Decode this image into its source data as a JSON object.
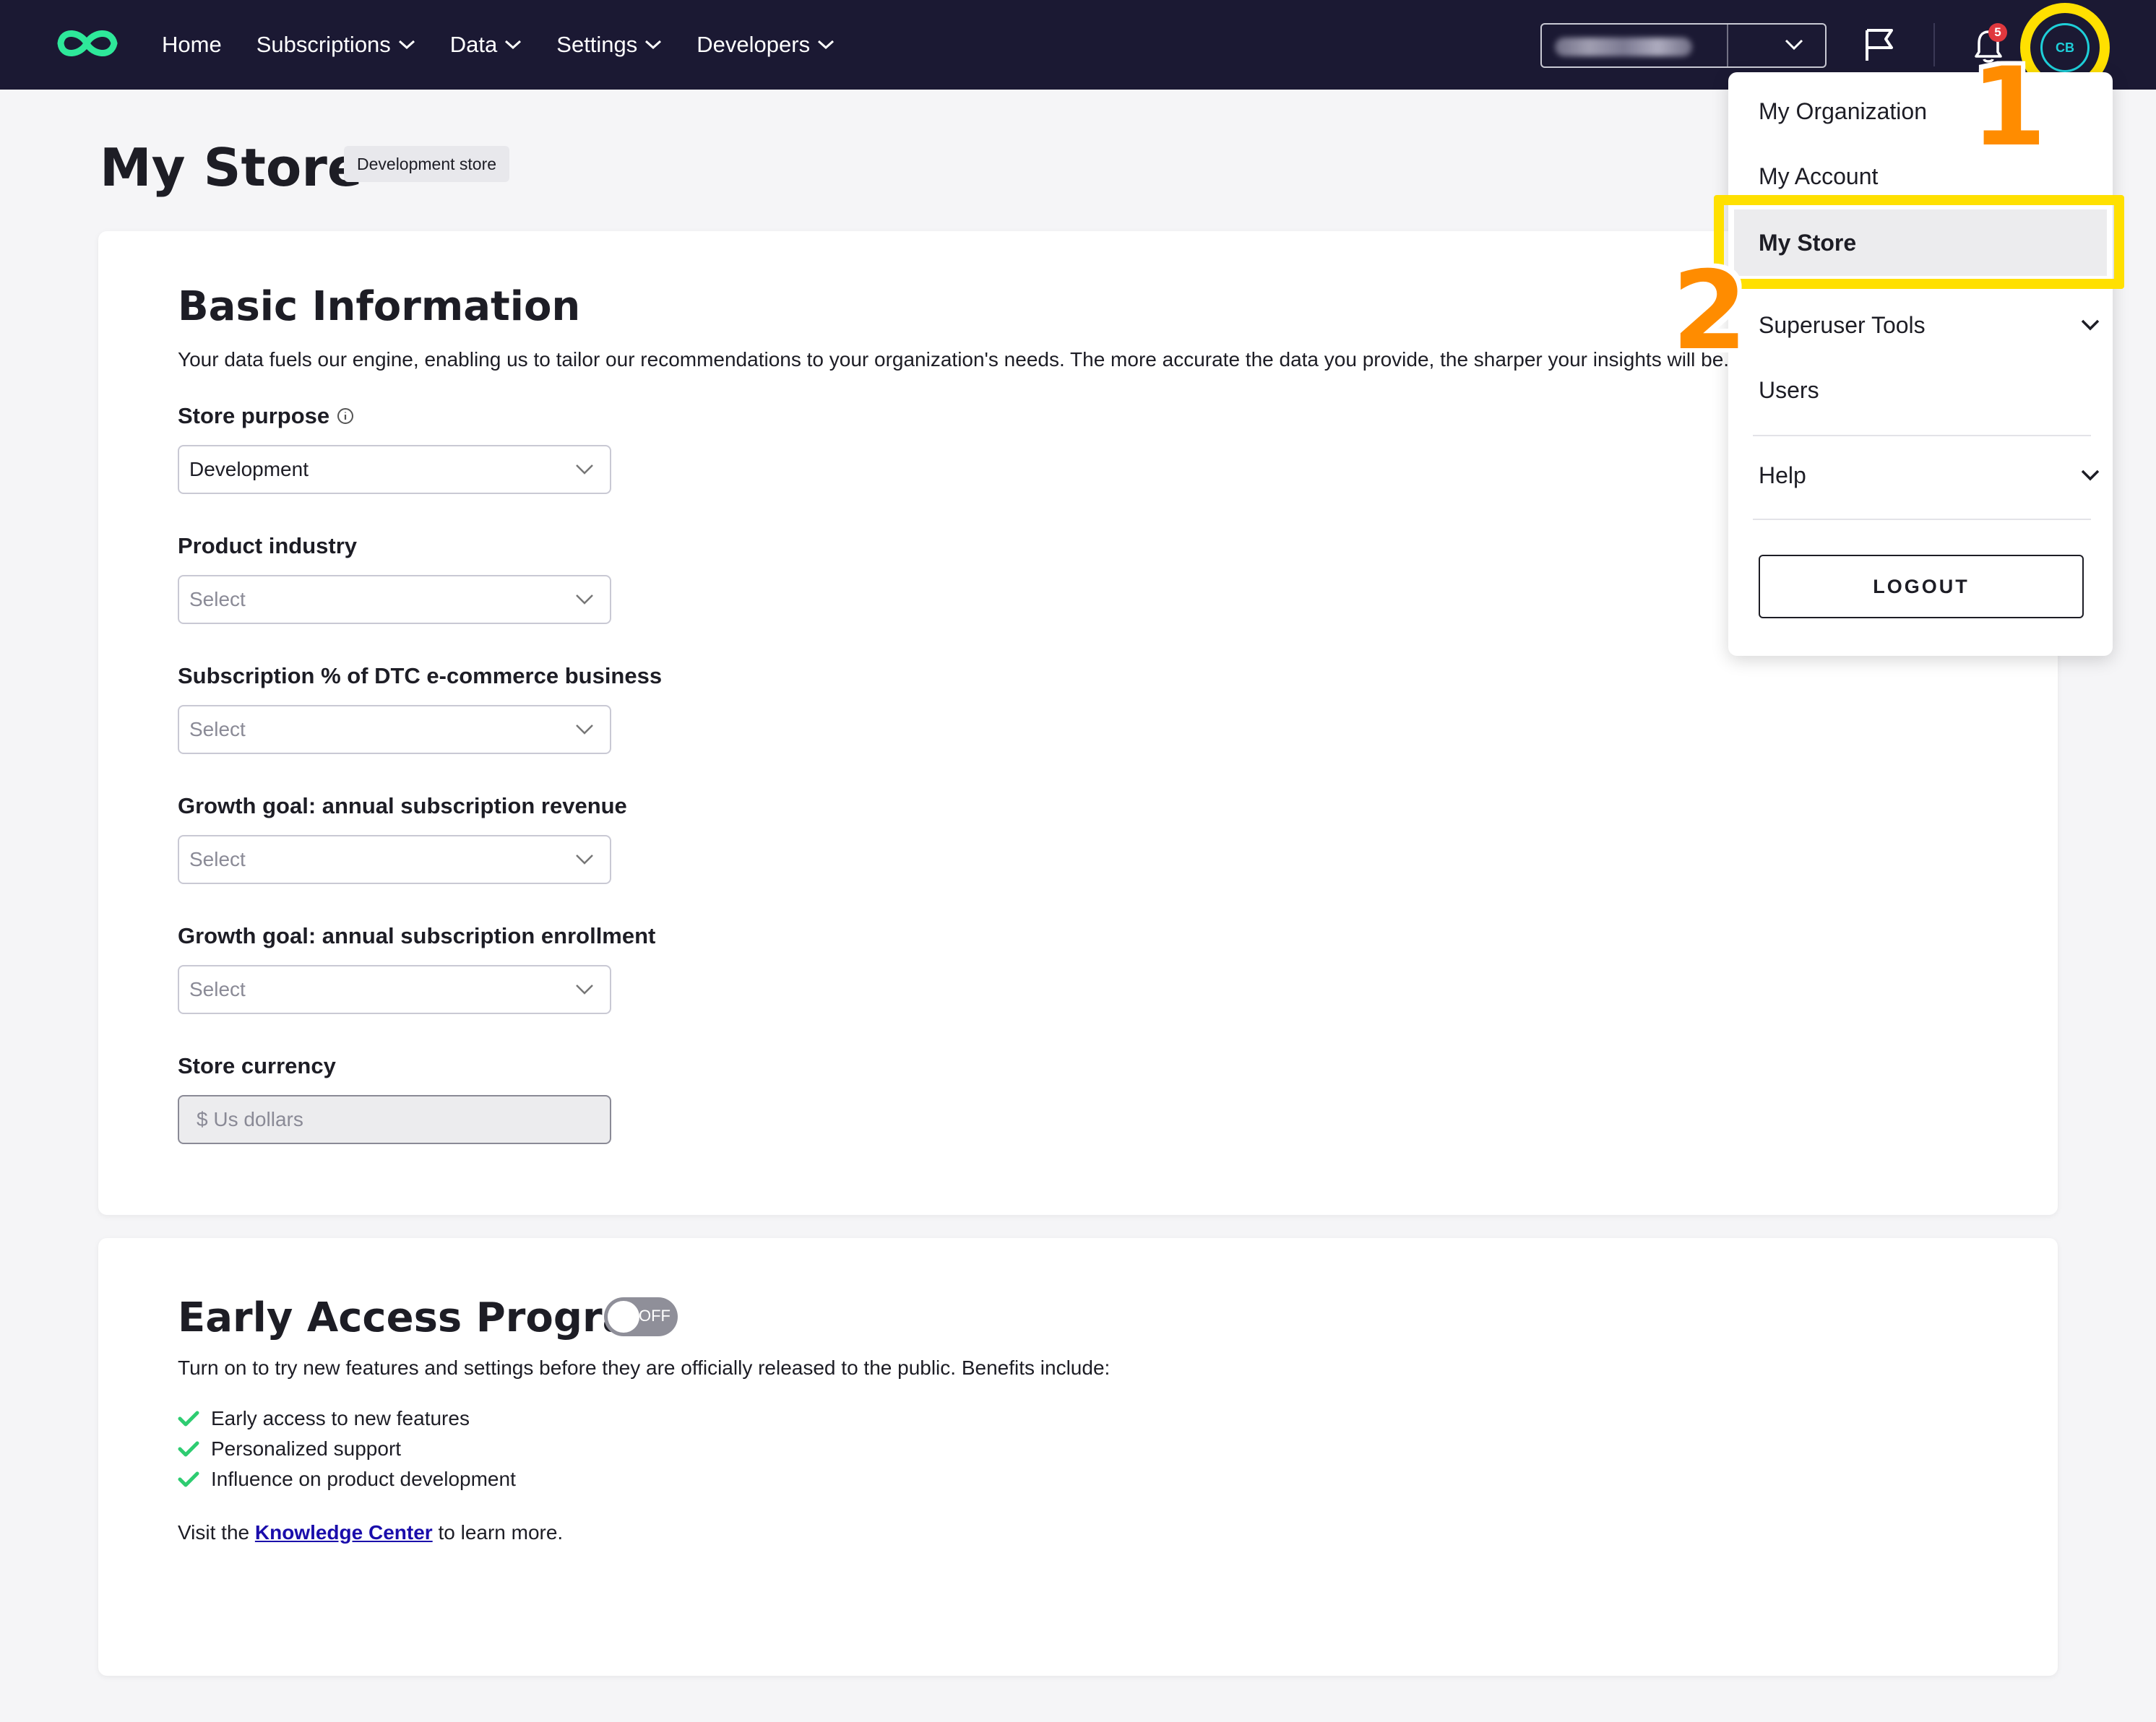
{
  "nav": {
    "items": [
      {
        "label": "Home"
      },
      {
        "label": "Subscriptions"
      },
      {
        "label": "Data"
      },
      {
        "label": "Settings"
      },
      {
        "label": "Developers"
      }
    ],
    "notification_count": "5",
    "avatar_initials": "CB"
  },
  "page": {
    "title": "My Store",
    "badge": "Development store"
  },
  "basic_info": {
    "title": "Basic Information",
    "description": "Your data fuels our engine, enabling us to tailor our recommendations to your organization's needs. The more accurate the data you provide, the sharper your insights will be.",
    "fields": [
      {
        "label": "Store purpose",
        "value": "Development"
      },
      {
        "label": "Product industry",
        "value": "Select"
      },
      {
        "label": "Subscription % of DTC e-commerce business",
        "value": "Select"
      },
      {
        "label": "Growth goal: annual subscription revenue",
        "value": "Select"
      },
      {
        "label": "Growth goal: annual subscription enrollment",
        "value": "Select"
      },
      {
        "label": "Store currency",
        "value": "$ Us dollars"
      }
    ]
  },
  "early_access": {
    "title": "Early Access Program",
    "toggle_label": "OFF",
    "description": "Turn on to try new features and settings before they are officially released to the public. Benefits include:",
    "benefits": [
      "Early access to new features",
      "Personalized support",
      "Influence on product development"
    ],
    "kc_prefix": "Visit the ",
    "kc_link": "Knowledge Center",
    "kc_suffix": " to learn more."
  },
  "user_menu": {
    "items": [
      {
        "label": "My Organization"
      },
      {
        "label": "My Account"
      },
      {
        "label": "My Store"
      },
      {
        "label": "Superuser Tools"
      },
      {
        "label": "Users"
      },
      {
        "label": "Help"
      }
    ],
    "logout": "LOGOUT"
  },
  "annotations": {
    "step1": "1",
    "step2": "2"
  },
  "colors": {
    "nav_bg": "#1b1933",
    "brand_green": "#2ee89a",
    "highlight": "#ffe000",
    "step_number": "#ff8c00",
    "check_green": "#2ecc71"
  }
}
